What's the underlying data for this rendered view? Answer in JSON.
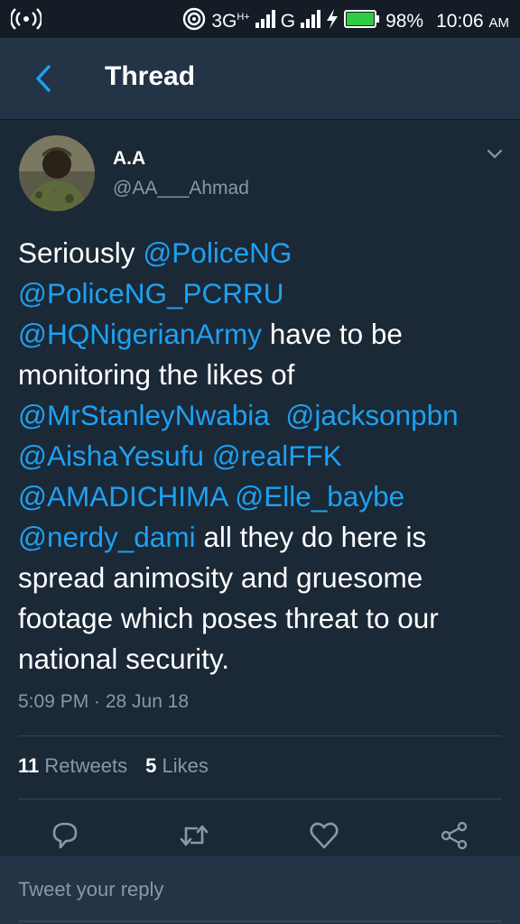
{
  "status_bar": {
    "network_type": "3G",
    "network_sup": "H+",
    "network2": "G",
    "battery_percent": "98%",
    "time": "10:06",
    "ampm": "AM",
    "icons": [
      "hotspot-icon",
      "wifi-icon",
      "signal-icon",
      "charging-icon",
      "battery-icon"
    ]
  },
  "header": {
    "title": "Thread"
  },
  "tweet": {
    "author_name": "A.A",
    "author_handle": "@AA___Ahmad",
    "text_lines": [
      [
        {
          "t": "Seriously ",
          "m": false
        },
        {
          "t": "@PoliceNG",
          "m": true
        }
      ],
      [
        {
          "t": "@PoliceNG_PCRRU",
          "m": true
        }
      ],
      [
        {
          "t": "@HQNigerianArmy",
          "m": true
        },
        {
          "t": " have to be",
          "m": false
        }
      ],
      [
        {
          "t": "monitoring the likes of",
          "m": false
        }
      ],
      [
        {
          "t": "@MrStanleyNwabia",
          "m": true
        },
        {
          "t": "  ",
          "m": false
        },
        {
          "t": "@jacksonpbn",
          "m": true
        }
      ],
      [
        {
          "t": "@AishaYesufu",
          "m": true
        },
        {
          "t": " ",
          "m": false
        },
        {
          "t": "@realFFK",
          "m": true
        }
      ],
      [
        {
          "t": "@AMADICHIMA",
          "m": true
        },
        {
          "t": " ",
          "m": false
        },
        {
          "t": "@Elle_baybe",
          "m": true
        }
      ],
      [
        {
          "t": "@nerdy_dami",
          "m": true
        },
        {
          "t": " all they do here is",
          "m": false
        }
      ],
      [
        {
          "t": "spread animosity and gruesome",
          "m": false
        }
      ],
      [
        {
          "t": "footage which poses threat to our",
          "m": false
        }
      ],
      [
        {
          "t": "national security.",
          "m": false
        }
      ]
    ],
    "timestamp": "5:09 PM · 28 Jun 18",
    "retweets_count": "11",
    "retweets_label": "Retweets",
    "likes_count": "5",
    "likes_label": "Likes"
  },
  "actions": [
    "reply-icon",
    "retweet-icon",
    "like-icon",
    "share-icon"
  ],
  "reply": {
    "placeholder": "Tweet your reply"
  },
  "colors": {
    "background": "#1b2836",
    "header": "#243447",
    "mention": "#1da1f2",
    "secondary_text": "#8899a6",
    "divider": "#38444d"
  }
}
